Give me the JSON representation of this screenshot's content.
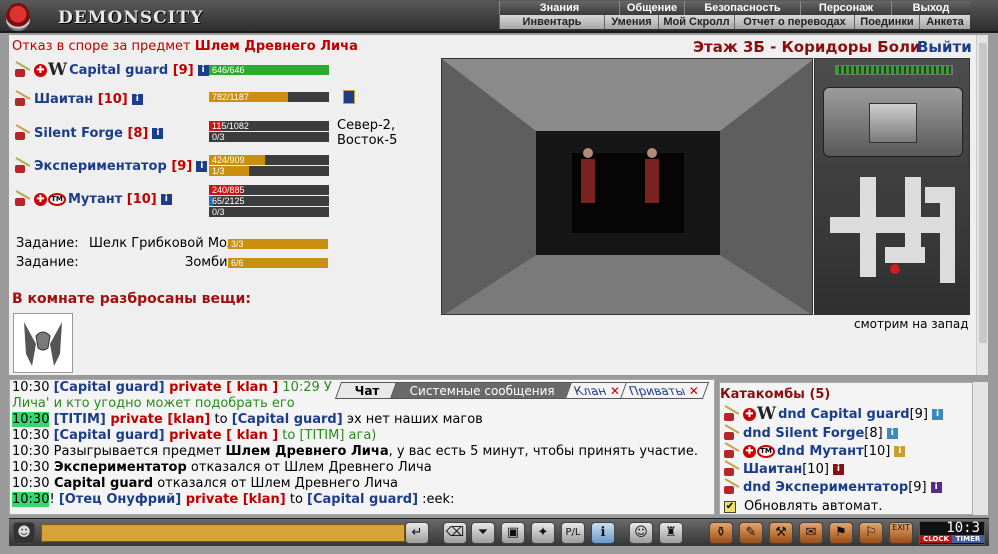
{
  "app": {
    "logo_text": "DEMONSCITY"
  },
  "nav_top": [
    "Знания",
    "Общение",
    "Безопасность",
    "Персонаж",
    "Выход"
  ],
  "nav_bottom": [
    "Инвентарь",
    "Умения",
    "Мой Скролл",
    "Отчет о переводах",
    "Поединки",
    "Анкета"
  ],
  "dispute": {
    "prefix": "Отказ в споре за предмет",
    "item": "Шлем Древнего Лича"
  },
  "location": {
    "title": "Этаж 3Б - Коридоры Боли",
    "exit": "Выйти",
    "view_label": "смотрим на запад"
  },
  "players": [
    {
      "name": "Capital guard",
      "level": "[9]",
      "bars": [
        "646/646"
      ],
      "bar_fill": [
        1.0
      ]
    },
    {
      "name": "Шаитан",
      "level": "[10]",
      "bars": [
        "782/1187"
      ],
      "bar_fill": [
        0.66
      ]
    },
    {
      "name": "Silent Forge",
      "level": "[8]",
      "bars": [
        "115/1082",
        "0/3"
      ],
      "bar_fill": [
        0.11,
        0.0
      ],
      "note": "Север-2, Восток-5"
    },
    {
      "name": "Экспериментатор",
      "level": "[9]",
      "bars": [
        "424/909",
        "1/3"
      ],
      "bar_fill": [
        0.47,
        0.33
      ]
    },
    {
      "name": "Мутант",
      "level": "[10]",
      "bars": [
        "240/885",
        "65/2125",
        "0/3"
      ],
      "bar_fill": [
        0.27,
        0.03,
        0.0
      ]
    }
  ],
  "tasks": [
    {
      "label": "Задание:",
      "what": "Шелк Грибковой Моли",
      "value": "3/3"
    },
    {
      "label": "Задание:",
      "what": "Зомби",
      "value": "6/6"
    }
  ],
  "items_heading": "В комнате разбросаны вещи:",
  "chat_tabs": [
    "Чат",
    "Системные сообщения",
    "Клан",
    "Приваты"
  ],
  "chat": [
    {
      "time": "10:30",
      "hl": false,
      "parts": [
        [
          "bb",
          "[Capital guard] "
        ],
        [
          "pv",
          "private [ klan ]"
        ],
        [
          "green",
          " 10:29 У"
        ]
      ]
    },
    {
      "time": "",
      "hl": false,
      "parts": [
        [
          "green",
          "Лича' и кто угодно может подобрать его"
        ]
      ]
    },
    {
      "time": "10:30",
      "hl": true,
      "parts": [
        [
          "bb",
          "[TITIM] "
        ],
        [
          "pv",
          "private [klan]"
        ],
        [
          "",
          " to "
        ],
        [
          "bb",
          "[Capital guard]"
        ],
        [
          "",
          " эх нет наших магов"
        ]
      ]
    },
    {
      "time": "10:30",
      "hl": false,
      "parts": [
        [
          "bb",
          "[Capital guard] "
        ],
        [
          "pv",
          "private [ klan ]"
        ],
        [
          "green",
          " to [TITIM] ага)"
        ]
      ]
    },
    {
      "time": "10:30",
      "hl": false,
      "parts": [
        [
          "",
          " Разыгрывается предмет "
        ],
        [
          "b",
          "Шлем Древнего Лича"
        ],
        [
          "",
          ", у вас есть 5 минут, чтобы принять участие."
        ]
      ]
    },
    {
      "time": "10:30",
      "hl": false,
      "parts": [
        [
          "b",
          " Экспериментатор"
        ],
        [
          "",
          " отказался от Шлем Древнего Лича"
        ]
      ]
    },
    {
      "time": "10:30",
      "hl": false,
      "parts": [
        [
          "b",
          " Capital guard"
        ],
        [
          "",
          " отказался от Шлем Древнего Лича"
        ]
      ]
    },
    {
      "time": "10:30",
      "hl": true,
      "parts": [
        [
          "",
          "! "
        ],
        [
          "bb",
          "[Отец Онуфрий] "
        ],
        [
          "pv",
          "private [klan]"
        ],
        [
          "",
          " to "
        ],
        [
          "bb",
          "[Capital guard]"
        ],
        [
          "",
          " :eek:"
        ]
      ]
    }
  ],
  "room_list": {
    "title": "Катакомбы (5)",
    "entries": [
      {
        "name": "dnd Capital guard",
        "level": "[9]"
      },
      {
        "name": "dnd Silent Forge",
        "level": "[8]"
      },
      {
        "name": "dnd Мутант",
        "level": "[10]"
      },
      {
        "name": "Шаитан",
        "level": "[10]"
      },
      {
        "name": "dnd Экспериментатор",
        "level": "[9]"
      }
    ],
    "auto_update": "Обновлять автомат."
  },
  "clock": {
    "time": "10:3",
    "labels": [
      "CLOCK",
      "TIMER"
    ]
  },
  "colors": {
    "green_bar": "#2fa82f",
    "gold_bar": "#c9900f",
    "red_bar": "#cc1414",
    "blue_bar": "#1b6fc0"
  }
}
